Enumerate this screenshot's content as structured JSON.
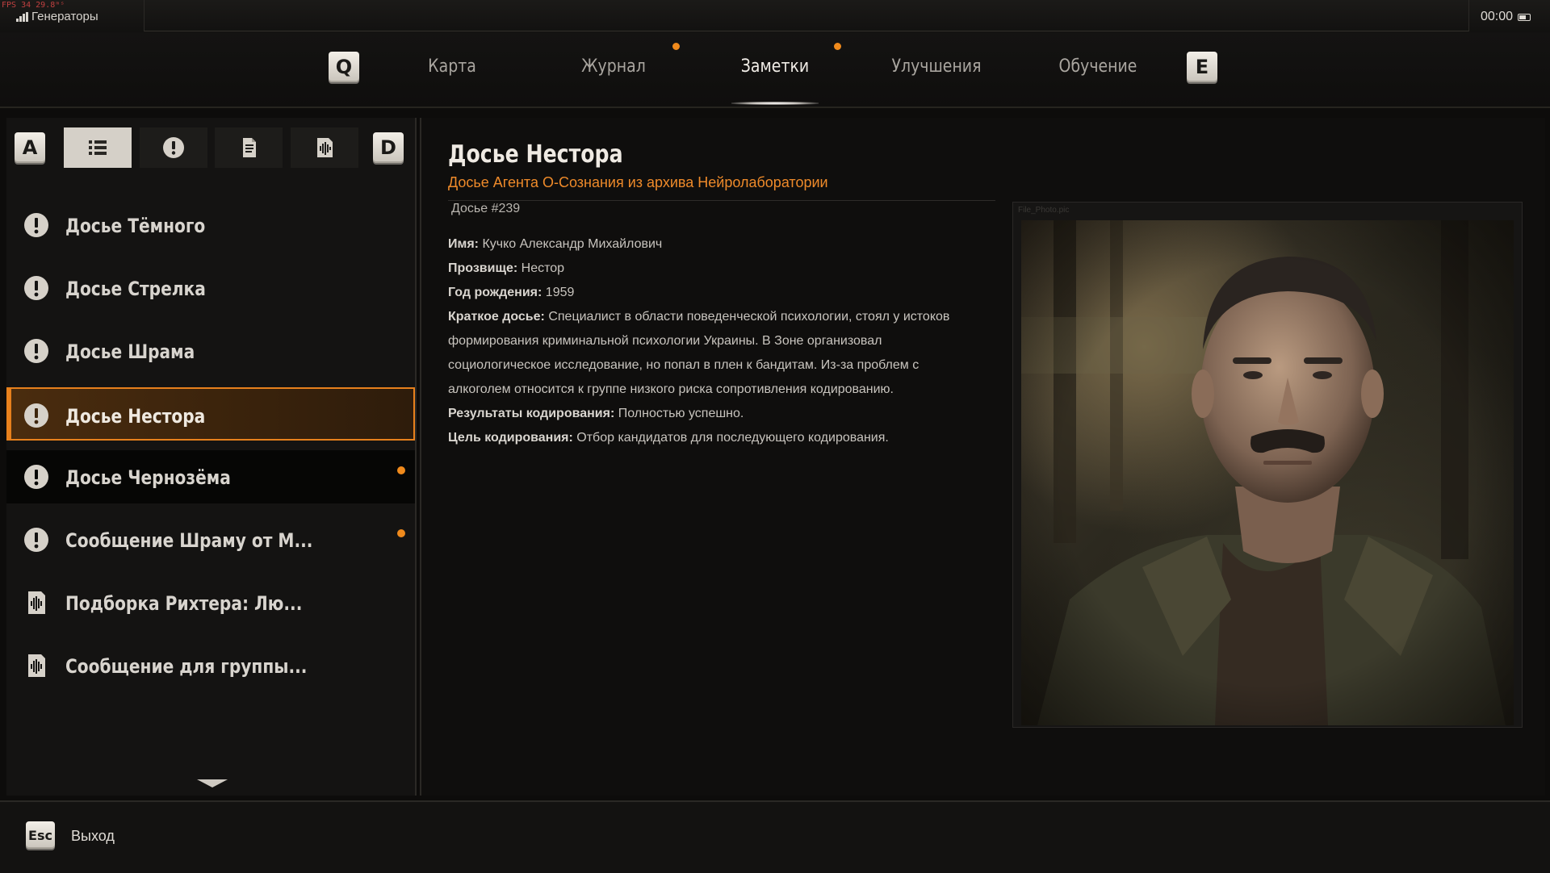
{
  "status": {
    "fps": "FPS  34  29.8ᵐˢ",
    "zone": "Генераторы",
    "clock": "00:00"
  },
  "nav": {
    "prev_key": "Q",
    "next_key": "E",
    "tabs": [
      {
        "label": "Карта",
        "active": false,
        "new": false
      },
      {
        "label": "Журнал",
        "active": false,
        "new": true
      },
      {
        "label": "Заметки",
        "active": true,
        "new": true
      },
      {
        "label": "Улучшения",
        "active": false,
        "new": false
      },
      {
        "label": "Обучение",
        "active": false,
        "new": false
      }
    ]
  },
  "filters": {
    "prev_key": "A",
    "next_key": "D",
    "buttons": [
      {
        "icon": "list-icon",
        "active": true
      },
      {
        "icon": "exclamation-icon",
        "active": false
      },
      {
        "icon": "document-icon",
        "active": false
      },
      {
        "icon": "audio-icon",
        "active": false
      }
    ]
  },
  "list": {
    "items": [
      {
        "label": "Досье Тёмного",
        "icon": "exclamation-icon",
        "new": false
      },
      {
        "label": "Досье Стрелка",
        "icon": "exclamation-icon",
        "new": false
      },
      {
        "label": "Досье Шрама",
        "icon": "exclamation-icon",
        "new": false
      },
      {
        "label": "Досье Нестора",
        "icon": "exclamation-icon",
        "new": false
      },
      {
        "label": "Досье Чернозёма",
        "icon": "exclamation-icon",
        "new": true
      },
      {
        "label": "Сообщение Шраму от М...",
        "icon": "exclamation-icon",
        "new": true
      },
      {
        "label": "Подборка Рихтера: Лю...",
        "icon": "audio-icon",
        "new": false
      },
      {
        "label": "Сообщение для группы...",
        "icon": "audio-icon",
        "new": false
      }
    ]
  },
  "detail": {
    "title": "Досье Нестора",
    "subtitle": "Досье Агента О-Сознания из архива Нейролаборатории",
    "number": "Досье #239",
    "fields": [
      {
        "label": "Имя:",
        "value": "Кучко Александр Михайлович"
      },
      {
        "label": "Прозвище:",
        "value": "Нестор"
      },
      {
        "label": "Год рождения:",
        "value": "1959"
      },
      {
        "label": "Краткое досье:",
        "value": "Специалист в области поведенческой психологии, стоял у истоков формирования криминальной психологии Украины. В Зоне организовал социологическое исследование, но попал в плен к бандитам. Из-за проблем с алкоголем относится к группе низкого риска сопротивления кодированию."
      },
      {
        "label": "Результаты кодирования:",
        "value": "Полностью успешно."
      },
      {
        "label": "Цель кодирования:",
        "value": "Отбор кандидатов для последующего кодирования."
      }
    ],
    "photo_caption": "File_Photo.pic"
  },
  "footer": {
    "exit_key": "Esc",
    "exit_label": "Выход"
  },
  "colors": {
    "accent": "#f08a1c",
    "selected_bg": "#3d250d"
  }
}
